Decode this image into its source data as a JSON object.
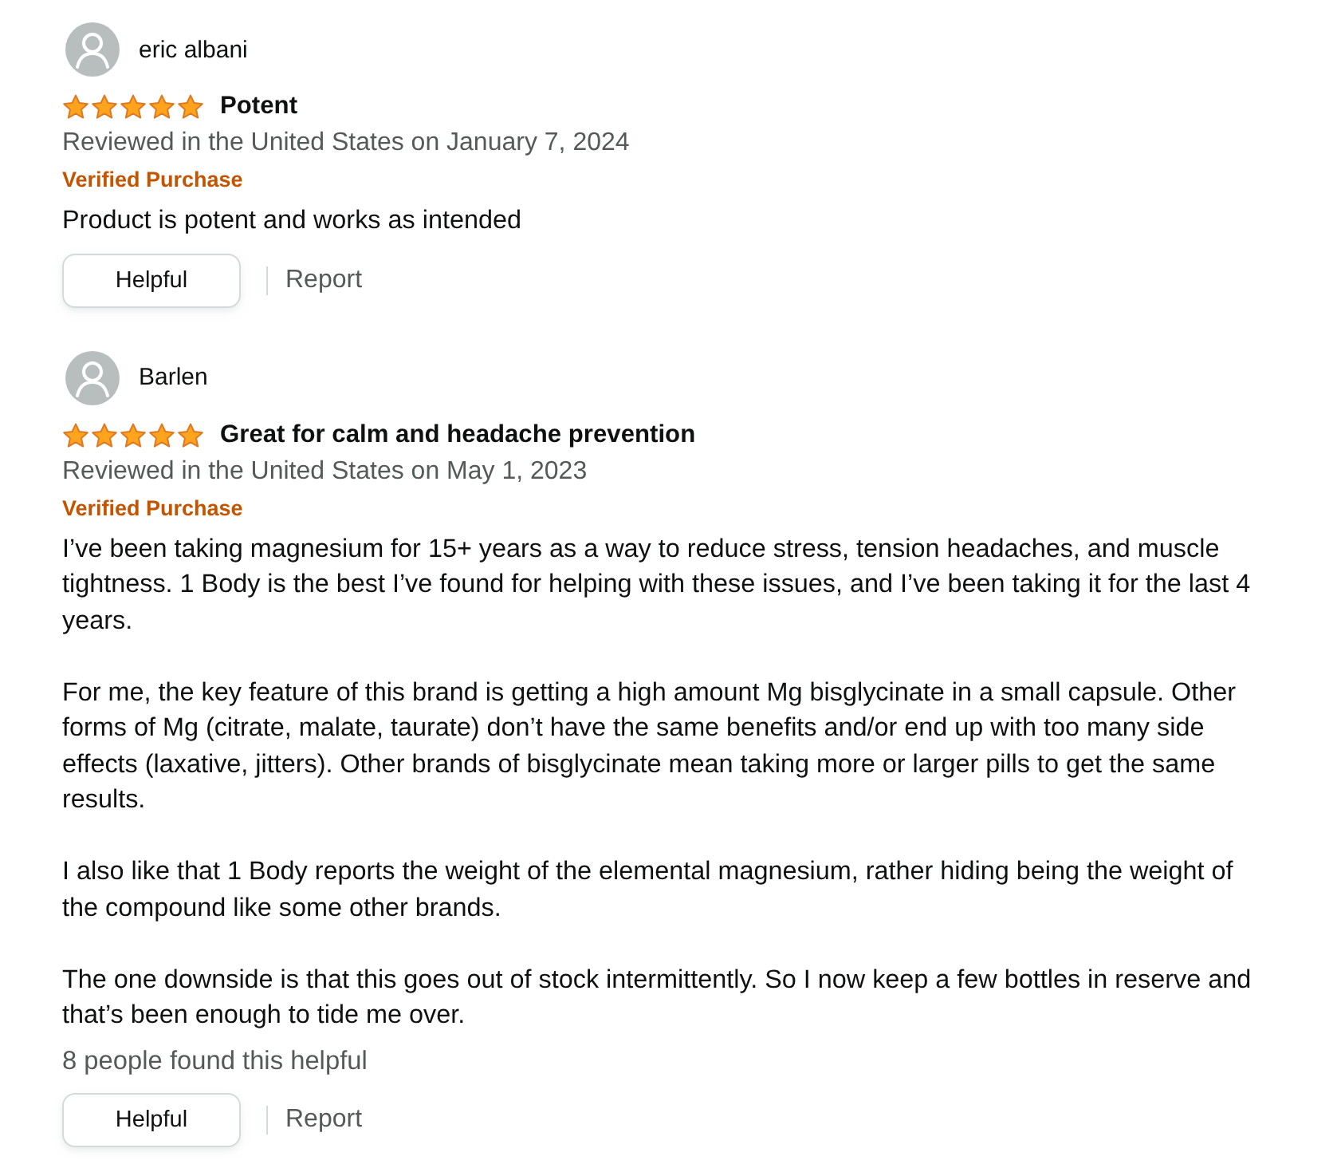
{
  "reviews": [
    {
      "reviewer": "eric albani",
      "stars": 5,
      "title": "Potent",
      "date": "Reviewed in the United States on January 7, 2024",
      "badge": "Verified Purchase",
      "paragraphs": [
        "Product is potent and works as intended"
      ],
      "actions": {
        "helpful": "Helpful",
        "report": "Report"
      }
    },
    {
      "reviewer": "Barlen",
      "stars": 5,
      "title": "Great for calm and headache prevention",
      "date": "Reviewed in the United States on May 1, 2023",
      "badge": "Verified Purchase",
      "paragraphs": [
        "I’ve been taking magnesium for 15+ years as a way to reduce stress, tension headaches, and muscle tightness. 1 Body is the best I’ve found for helping with these issues, and I’ve been taking it for the last 4 years.",
        "For me, the key feature of this brand is getting a high amount Mg bisglycinate in a small capsule. Other forms of Mg (citrate, malate, taurate) don’t have the same benefits and/or end up with too many side effects (laxative, jitters). Other brands of bisglycinate mean taking more or larger pills to get the same results.",
        "I also like that 1 Body reports the weight of the elemental magnesium, rather hiding being the weight of the compound like some other brands.",
        "The one downside is that this goes out of stock intermittently. So I now keep a few bottles in reserve and that’s been enough to tide me over."
      ],
      "helpful_count": "8 people found this helpful",
      "actions": {
        "helpful": "Helpful",
        "report": "Report"
      }
    }
  ]
}
